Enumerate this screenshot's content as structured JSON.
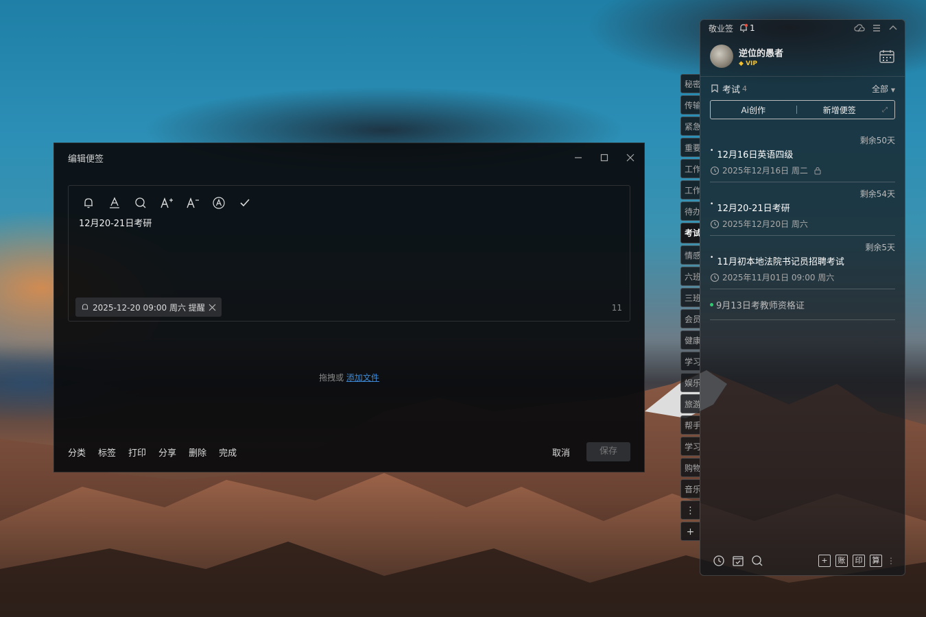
{
  "editor": {
    "title": "编辑便签",
    "content": "12月20-21日考研",
    "reminder": "2025-12-20 09:00 周六 提醒",
    "char_count": "11",
    "drop_text": "拖拽或",
    "drop_link": "添加文件",
    "footer_left": [
      "分类",
      "标签",
      "打印",
      "分享",
      "删除",
      "完成"
    ],
    "cancel": "取消",
    "save": "保存",
    "toolbar_icons": [
      "bell-icon",
      "font-color-icon",
      "search-icon",
      "font-increase-icon",
      "font-decrease-icon",
      "font-style-icon",
      "check-icon"
    ]
  },
  "side_tabs": [
    "秘密",
    "传输",
    "紧急",
    "重要",
    "工作",
    "工作",
    "待办",
    "考试",
    "情感",
    "六班",
    "三班",
    "会员",
    "健康",
    "学习",
    "娱乐",
    "旅游",
    "帮手",
    "学习",
    "购物",
    "音乐"
  ],
  "side_tab_active": 7,
  "panel": {
    "app_name": "敬业签",
    "notify_count": "1",
    "username": "逆位的愚者",
    "vip": "VIP",
    "category": "考试",
    "category_count": "4",
    "filter": "全部",
    "ai_button": "Ai创作",
    "new_button": "新增便签",
    "notes": [
      {
        "remain": "剩余50天",
        "title": "12月16日英语四级",
        "date": "2025年12月16日 周二"
      },
      {
        "remain": "剩余54天",
        "title": "12月20-21日考研",
        "date": "2025年12月20日 周六"
      },
      {
        "remain": "剩余5天",
        "title": "11月初本地法院书记员招聘考试",
        "date": "2025年11月01日 09:00 周六"
      }
    ],
    "done_note": "9月13日考教师资格证",
    "bottom_right": [
      "+",
      "账",
      "印",
      "算"
    ]
  },
  "colors": {
    "accent_link": "#3d8bd8",
    "done_dot": "#2ecc71",
    "notify": "#e74c3c",
    "vip": "#f2c230"
  }
}
